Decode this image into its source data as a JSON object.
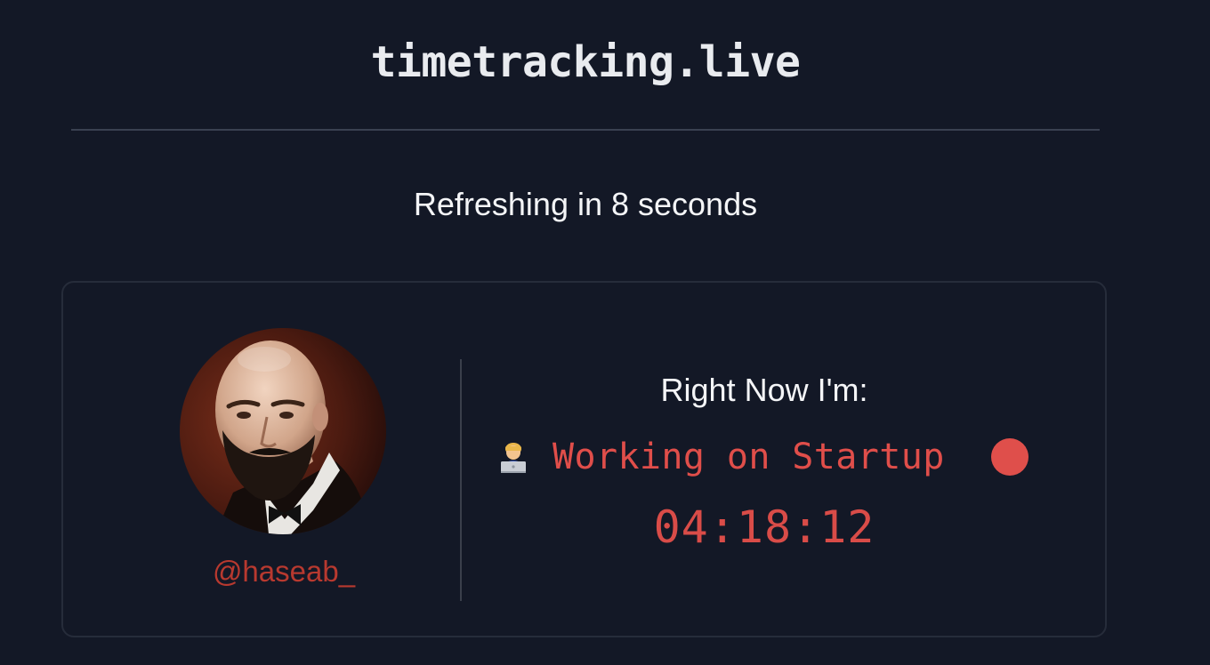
{
  "header": {
    "site_title": "timetracking.live"
  },
  "refresh": {
    "text": "Refreshing in 8 seconds",
    "seconds_remaining": 8
  },
  "profile": {
    "handle": "@haseab_",
    "avatar_icon": "profile-photo-bearded-man"
  },
  "status": {
    "heading": "Right Now I'm:",
    "emoji_icon": "technologist-laptop-emoji",
    "activity": "Working on Startup",
    "indicator_icon": "recording-dot-icon",
    "timer": "04:18:12"
  },
  "colors": {
    "background": "#131826",
    "accent_red": "#e04e4a",
    "handle_red": "#b8392f",
    "card_border": "#262c3a"
  }
}
